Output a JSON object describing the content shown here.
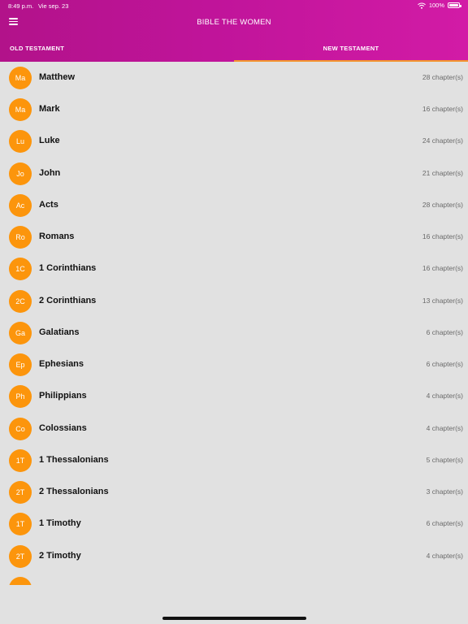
{
  "status_bar": {
    "time": "8:49 p.m.",
    "date": "Vie sep. 23",
    "battery": "100%"
  },
  "app": {
    "title": "BIBLE THE WOMEN"
  },
  "tabs": [
    {
      "label": "OLD TESTAMENT",
      "selected": false
    },
    {
      "label": "NEW TESTAMENT",
      "selected": true
    }
  ],
  "colors": {
    "header_start": "#b2128a",
    "header_end": "#d21ba6",
    "avatar": "#fc950c",
    "tab_indicator": "#f3942e",
    "background": "#e1e1e1"
  },
  "books": [
    {
      "abbr": "Ma",
      "name": "Matthew",
      "chapters": "28 chapter(s)"
    },
    {
      "abbr": "Ma",
      "name": "Mark",
      "chapters": "16 chapter(s)"
    },
    {
      "abbr": "Lu",
      "name": "Luke",
      "chapters": "24 chapter(s)"
    },
    {
      "abbr": "Jo",
      "name": "John",
      "chapters": "21 chapter(s)"
    },
    {
      "abbr": "Ac",
      "name": "Acts",
      "chapters": "28 chapter(s)"
    },
    {
      "abbr": "Ro",
      "name": "Romans",
      "chapters": "16 chapter(s)"
    },
    {
      "abbr": "1C",
      "name": "1 Corinthians",
      "chapters": "16 chapter(s)"
    },
    {
      "abbr": "2C",
      "name": "2 Corinthians",
      "chapters": "13 chapter(s)"
    },
    {
      "abbr": "Ga",
      "name": "Galatians",
      "chapters": "6 chapter(s)"
    },
    {
      "abbr": "Ep",
      "name": "Ephesians",
      "chapters": "6 chapter(s)"
    },
    {
      "abbr": "Ph",
      "name": "Philippians",
      "chapters": "4 chapter(s)"
    },
    {
      "abbr": "Co",
      "name": "Colossians",
      "chapters": "4 chapter(s)"
    },
    {
      "abbr": "1T",
      "name": "1 Thessalonians",
      "chapters": "5 chapter(s)"
    },
    {
      "abbr": "2T",
      "name": "2 Thessalonians",
      "chapters": "3 chapter(s)"
    },
    {
      "abbr": "1T",
      "name": "1 Timothy",
      "chapters": "6 chapter(s)"
    },
    {
      "abbr": "2T",
      "name": "2 Timothy",
      "chapters": "4 chapter(s)"
    },
    {
      "abbr": "",
      "name": "",
      "chapters": ""
    }
  ]
}
